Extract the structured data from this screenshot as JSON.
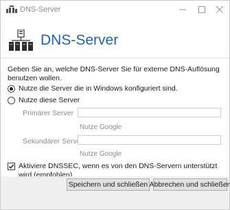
{
  "window": {
    "title": "DNS-Server",
    "minimize_icon": "minimize-icon",
    "maximize_icon": "maximize-icon",
    "close_icon": "close-icon"
  },
  "header": {
    "title": "DNS-Server",
    "icon": "dns-server-icon"
  },
  "intro_text": "Geben Sie an, welche DNS-Server Sie für externe DNS-Auflösung benutzen wollen.",
  "options": {
    "windows_servers": {
      "label": "Nutze die Server die in Windows konfiguriert sind.",
      "selected": true
    },
    "custom_servers": {
      "label": "Nutze diese Server",
      "selected": false
    }
  },
  "primary": {
    "label": "Primärer Server",
    "value": "",
    "link": "Nutze Google"
  },
  "secondary": {
    "label": "Sekundärer Server",
    "value": "",
    "link": "Nutze Google"
  },
  "dnssec": {
    "label": "Aktiviere DNSSEC, wenn es von den DNS-Servern unterstützt wird (empfohlen)",
    "checked": true
  },
  "buttons": {
    "save": "Speichern und schließen",
    "cancel": "Abbrechen und schließen"
  },
  "colors": {
    "accent": "#1f63b5",
    "disabled_text": "#8c8c8c"
  }
}
